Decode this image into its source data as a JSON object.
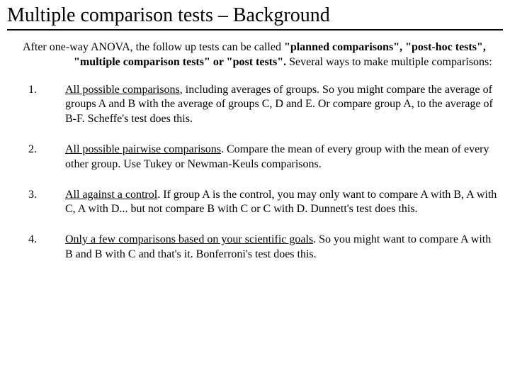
{
  "title": "Multiple comparison tests – Background",
  "intro": {
    "lead": "After one-way ANOVA, the follow up tests can be called ",
    "bold": "\"planned comparisons\", \"post-hoc tests\", \"multiple comparison tests\" or \"post tests\".",
    "tail": "  Several ways to make multiple comparisons:"
  },
  "items": [
    {
      "num": "1.",
      "underlined": " All possible comparisons",
      "rest": ", including averages of groups. So you might compare the average of groups A and B with the average of groups C, D and E. Or compare group A, to the average of B-F. Scheffe's test does this."
    },
    {
      "num": "2.",
      "underlined": "All possible pairwise comparisons",
      "rest": ". Compare the mean of every group with the mean of every other group. Use Tukey or Newman-Keuls comparisons."
    },
    {
      "num": "3.",
      "underlined": "All against a control",
      "rest": ". If group A is the control, you may only want to compare A with B, A with C, A with D... but not compare B with C or C with D. Dunnett's test does this."
    },
    {
      "num": "4.",
      "underlined": "Only a few comparisons based on your scientific goals",
      "rest": ". So you might want to compare A with B and B with C and that's it. Bonferroni's test does this."
    }
  ]
}
